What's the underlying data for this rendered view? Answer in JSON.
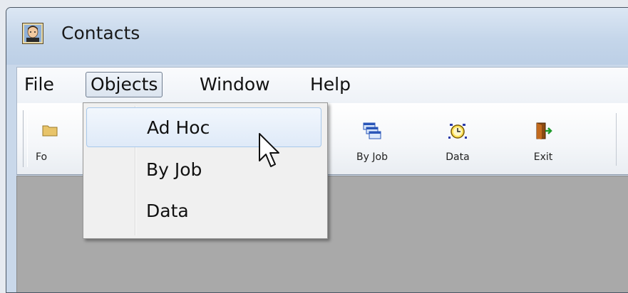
{
  "window": {
    "title": "Contacts"
  },
  "menubar": {
    "items": [
      {
        "label": "File"
      },
      {
        "label": "Objects"
      },
      {
        "label": "Window"
      },
      {
        "label": "Help"
      }
    ]
  },
  "toolbar": {
    "buttons": [
      {
        "label": "Fo",
        "icon": "folder-icon"
      },
      {
        "label": "By Job",
        "icon": "stacked-windows-icon"
      },
      {
        "label": "Data",
        "icon": "alarm-clock-icon"
      },
      {
        "label": "Exit",
        "icon": "exit-door-icon"
      }
    ]
  },
  "dropdown": {
    "menu": "Objects",
    "items": [
      {
        "label": "Ad Hoc",
        "state": "hover"
      },
      {
        "label": "By Job"
      },
      {
        "label": "Data"
      }
    ]
  },
  "colors": {
    "title_bar": "#c5d6ea",
    "client_area": "#a9a9a9",
    "menu_highlight": "#dfeaf8"
  }
}
